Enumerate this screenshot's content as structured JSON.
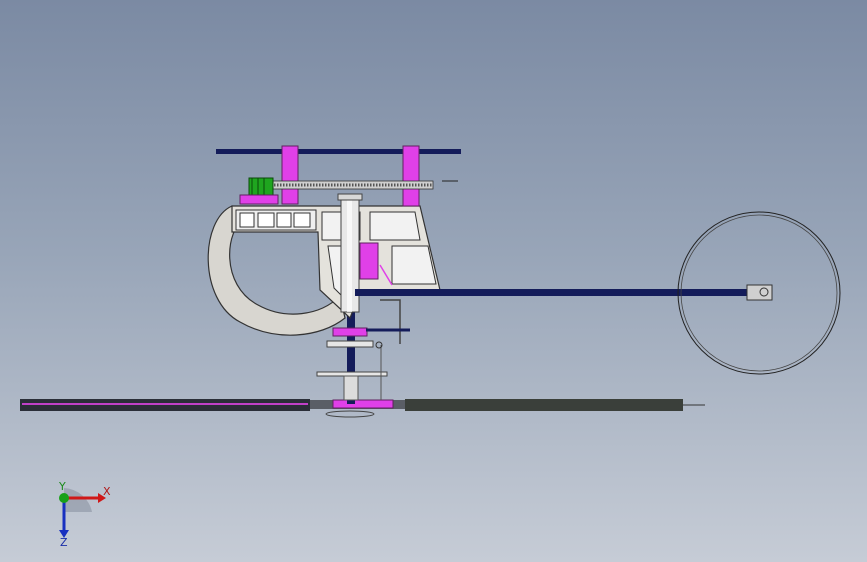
{
  "scene": {
    "background_top": "#7b8aa3",
    "background_bottom": "#c6ccd6",
    "accent_magenta": "#e040e8",
    "shaft_navy": "#141c5a",
    "body_light": "#e6e6e6"
  },
  "triad": {
    "x_label": "X",
    "y_label": "Y",
    "z_label": "Z",
    "x_color": "#d01818",
    "y_color": "#18a018",
    "z_color": "#1830c0"
  }
}
